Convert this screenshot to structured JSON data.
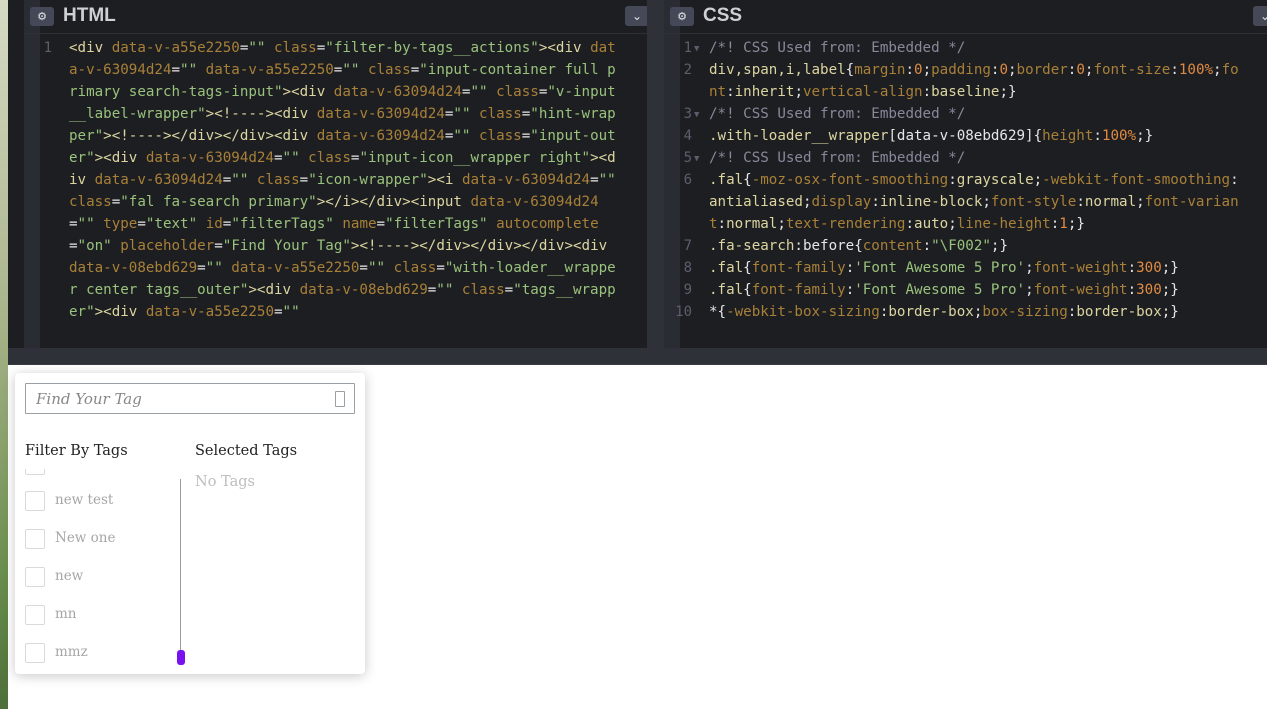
{
  "colors": {
    "editor_bg": "#1d1e22",
    "tag": "#dcd5a0",
    "attr": "#a88038",
    "value": "#99c27c",
    "comment": "#88889a",
    "number": "#e08b43",
    "accent": "#7a12f0"
  },
  "html_panel": {
    "title": "HTML",
    "settings_icon": "gear-icon",
    "collapse_icon": "chevron-down-icon",
    "lines": [
      {
        "n": "1",
        "tokens": [
          {
            "t": "<div ",
            "c": "tag"
          },
          {
            "t": "data-v-a55e2250",
            "c": "attr"
          },
          {
            "t": "=",
            "c": "plain"
          },
          {
            "t": "\"\" ",
            "c": "value"
          },
          {
            "t": "class",
            "c": "attr"
          },
          {
            "t": "=",
            "c": "plain"
          },
          {
            "t": "\"filter-by-tags__actions\"",
            "c": "value"
          },
          {
            "t": "><div ",
            "c": "tag"
          },
          {
            "t": "data-v-63094d24",
            "c": "attr"
          },
          {
            "t": "=",
            "c": "plain"
          },
          {
            "t": "\"\" ",
            "c": "value"
          },
          {
            "t": "data-v-a55e2250",
            "c": "attr"
          },
          {
            "t": "=",
            "c": "plain"
          },
          {
            "t": "\"\" ",
            "c": "value"
          },
          {
            "t": "class",
            "c": "attr"
          },
          {
            "t": "=",
            "c": "plain"
          },
          {
            "t": "\"input-container full primary search-tags-input\"",
            "c": "value"
          },
          {
            "t": "><div ",
            "c": "tag"
          },
          {
            "t": "data-v-63094d24",
            "c": "attr"
          },
          {
            "t": "=",
            "c": "plain"
          },
          {
            "t": "\"\" ",
            "c": "value"
          },
          {
            "t": "class",
            "c": "attr"
          },
          {
            "t": "=",
            "c": "plain"
          },
          {
            "t": "\"v-input__label-wrapper\"",
            "c": "value"
          },
          {
            "t": "><!---->",
            "c": "tag"
          },
          {
            "t": "<div ",
            "c": "tag"
          },
          {
            "t": "data-v-63094d24",
            "c": "attr"
          },
          {
            "t": "=",
            "c": "plain"
          },
          {
            "t": "\"\" ",
            "c": "value"
          },
          {
            "t": "class",
            "c": "attr"
          },
          {
            "t": "=",
            "c": "plain"
          },
          {
            "t": "\"hint-wrapper\"",
            "c": "value"
          },
          {
            "t": "><!----></div></div><div ",
            "c": "tag"
          },
          {
            "t": "data-v-63094d24",
            "c": "attr"
          },
          {
            "t": "=",
            "c": "plain"
          },
          {
            "t": "\"\" ",
            "c": "value"
          },
          {
            "t": "class",
            "c": "attr"
          },
          {
            "t": "=",
            "c": "plain"
          },
          {
            "t": "\"input-outer\"",
            "c": "value"
          },
          {
            "t": "><div ",
            "c": "tag"
          },
          {
            "t": "data-v-63094d24",
            "c": "attr"
          },
          {
            "t": "=",
            "c": "plain"
          },
          {
            "t": "\"\" ",
            "c": "value"
          },
          {
            "t": "class",
            "c": "attr"
          },
          {
            "t": "=",
            "c": "plain"
          },
          {
            "t": "\"input-icon__wrapper right\"",
            "c": "value"
          },
          {
            "t": "><div ",
            "c": "tag"
          },
          {
            "t": "data-v-63094d24",
            "c": "attr"
          },
          {
            "t": "=",
            "c": "plain"
          },
          {
            "t": "\"\" ",
            "c": "value"
          },
          {
            "t": "class",
            "c": "attr"
          },
          {
            "t": "=",
            "c": "plain"
          },
          {
            "t": "\"icon-wrapper\"",
            "c": "value"
          },
          {
            "t": "><i ",
            "c": "tag"
          },
          {
            "t": "data-v-63094d24",
            "c": "attr"
          },
          {
            "t": "=",
            "c": "plain"
          },
          {
            "t": "\"\" ",
            "c": "value"
          },
          {
            "t": "class",
            "c": "attr"
          },
          {
            "t": "=",
            "c": "plain"
          },
          {
            "t": "\"fal fa-search primary\"",
            "c": "value"
          },
          {
            "t": "></i></div><input ",
            "c": "tag"
          },
          {
            "t": "data-v-63094d24",
            "c": "attr"
          },
          {
            "t": "=",
            "c": "plain"
          },
          {
            "t": "\"\" ",
            "c": "value"
          },
          {
            "t": "type",
            "c": "attr"
          },
          {
            "t": "=",
            "c": "plain"
          },
          {
            "t": "\"text\" ",
            "c": "value"
          },
          {
            "t": "id",
            "c": "attr"
          },
          {
            "t": "=",
            "c": "plain"
          },
          {
            "t": "\"filterTags\" ",
            "c": "value"
          },
          {
            "t": "name",
            "c": "attr"
          },
          {
            "t": "=",
            "c": "plain"
          },
          {
            "t": "\"filterTags\" ",
            "c": "value"
          },
          {
            "t": "autocomplete",
            "c": "attr"
          },
          {
            "t": "=",
            "c": "plain"
          },
          {
            "t": "\"on\" ",
            "c": "value"
          },
          {
            "t": "placeholder",
            "c": "attr"
          },
          {
            "t": "=",
            "c": "plain"
          },
          {
            "t": "\"Find Your Tag\"",
            "c": "value"
          },
          {
            "t": "><!----></div></div></div><div ",
            "c": "tag"
          },
          {
            "t": "data-v-08ebd629",
            "c": "attr"
          },
          {
            "t": "=",
            "c": "plain"
          },
          {
            "t": "\"\" ",
            "c": "value"
          },
          {
            "t": "data-v-a55e2250",
            "c": "attr"
          },
          {
            "t": "=",
            "c": "plain"
          },
          {
            "t": "\"\" ",
            "c": "value"
          },
          {
            "t": "class",
            "c": "attr"
          },
          {
            "t": "=",
            "c": "plain"
          },
          {
            "t": "\"with-loader__wrapper center tags__outer\"",
            "c": "value"
          },
          {
            "t": "><div ",
            "c": "tag"
          },
          {
            "t": "data-v-08ebd629",
            "c": "attr"
          },
          {
            "t": "=",
            "c": "plain"
          },
          {
            "t": "\"\" ",
            "c": "value"
          },
          {
            "t": "class",
            "c": "attr"
          },
          {
            "t": "=",
            "c": "plain"
          },
          {
            "t": "\"tags__wrapper\"",
            "c": "value"
          },
          {
            "t": "><div ",
            "c": "tag"
          },
          {
            "t": "data-v-a55e2250",
            "c": "attr"
          },
          {
            "t": "=",
            "c": "plain"
          },
          {
            "t": "\"\"",
            "c": "value"
          }
        ]
      }
    ]
  },
  "css_panel": {
    "title": "CSS",
    "settings_icon": "gear-icon",
    "collapse_icon": "chevron-down-icon",
    "lines": [
      {
        "n": "1",
        "fold": true,
        "tokens": [
          {
            "t": "/*! CSS Used from: Embedded */",
            "c": "comment"
          }
        ]
      },
      {
        "n": "2",
        "tokens": [
          {
            "t": "div,span,i,label",
            "c": "tag"
          },
          {
            "t": "{",
            "c": "plain"
          },
          {
            "t": "margin",
            "c": "prop"
          },
          {
            "t": ":",
            "c": "plain"
          },
          {
            "t": "0",
            "c": "number"
          },
          {
            "t": ";",
            "c": "plain"
          },
          {
            "t": "padding",
            "c": "prop"
          },
          {
            "t": ":",
            "c": "plain"
          },
          {
            "t": "0",
            "c": "number"
          },
          {
            "t": ";",
            "c": "plain"
          },
          {
            "t": "border",
            "c": "prop"
          },
          {
            "t": ":",
            "c": "plain"
          },
          {
            "t": "0",
            "c": "number"
          },
          {
            "t": ";",
            "c": "plain"
          },
          {
            "t": "font-size",
            "c": "prop"
          },
          {
            "t": ":",
            "c": "plain"
          },
          {
            "t": "100%",
            "c": "number"
          },
          {
            "t": ";",
            "c": "plain"
          },
          {
            "t": "font",
            "c": "prop"
          },
          {
            "t": ":",
            "c": "plain"
          },
          {
            "t": "inherit",
            "c": "kw"
          },
          {
            "t": ";",
            "c": "plain"
          },
          {
            "t": "vertical-align",
            "c": "prop"
          },
          {
            "t": ":",
            "c": "plain"
          },
          {
            "t": "baseline",
            "c": "kw"
          },
          {
            "t": ";}",
            "c": "plain"
          }
        ]
      },
      {
        "n": "3",
        "fold": true,
        "tokens": [
          {
            "t": "/*! CSS Used from: Embedded */",
            "c": "comment"
          }
        ]
      },
      {
        "n": "4",
        "tokens": [
          {
            "t": ".with-loader__wrapper",
            "c": "tag"
          },
          {
            "t": "[data-v-08ebd629]",
            "c": "plain"
          },
          {
            "t": "{",
            "c": "plain"
          },
          {
            "t": "height",
            "c": "prop"
          },
          {
            "t": ":",
            "c": "plain"
          },
          {
            "t": "100%",
            "c": "number"
          },
          {
            "t": ";}",
            "c": "plain"
          }
        ]
      },
      {
        "n": "5",
        "fold": true,
        "tokens": [
          {
            "t": "/*! CSS Used from: Embedded */",
            "c": "comment"
          }
        ]
      },
      {
        "n": "6",
        "tokens": [
          {
            "t": ".fal",
            "c": "tag"
          },
          {
            "t": "{",
            "c": "plain"
          },
          {
            "t": "-moz-osx-font-smoothing",
            "c": "prop"
          },
          {
            "t": ":",
            "c": "plain"
          },
          {
            "t": "grayscale",
            "c": "kw"
          },
          {
            "t": ";",
            "c": "plain"
          },
          {
            "t": "-webkit-font-smoothing",
            "c": "prop"
          },
          {
            "t": ":",
            "c": "plain"
          },
          {
            "t": "antialiased",
            "c": "kw"
          },
          {
            "t": ";",
            "c": "plain"
          },
          {
            "t": "display",
            "c": "prop"
          },
          {
            "t": ":",
            "c": "plain"
          },
          {
            "t": "inline-block",
            "c": "kw"
          },
          {
            "t": ";",
            "c": "plain"
          },
          {
            "t": "font-style",
            "c": "prop"
          },
          {
            "t": ":",
            "c": "plain"
          },
          {
            "t": "normal",
            "c": "kw"
          },
          {
            "t": ";",
            "c": "plain"
          },
          {
            "t": "font-variant",
            "c": "prop"
          },
          {
            "t": ":",
            "c": "plain"
          },
          {
            "t": "normal",
            "c": "kw"
          },
          {
            "t": ";",
            "c": "plain"
          },
          {
            "t": "text-rendering",
            "c": "prop"
          },
          {
            "t": ":",
            "c": "plain"
          },
          {
            "t": "auto",
            "c": "kw"
          },
          {
            "t": ";",
            "c": "plain"
          },
          {
            "t": "line-height",
            "c": "prop"
          },
          {
            "t": ":",
            "c": "plain"
          },
          {
            "t": "1",
            "c": "number"
          },
          {
            "t": ";}",
            "c": "plain"
          }
        ]
      },
      {
        "n": "7",
        "tokens": [
          {
            "t": ".fa-search",
            "c": "tag"
          },
          {
            "t": ":before{",
            "c": "plain"
          },
          {
            "t": "content",
            "c": "prop"
          },
          {
            "t": ":",
            "c": "plain"
          },
          {
            "t": "\"\\F002\"",
            "c": "value"
          },
          {
            "t": ";}",
            "c": "plain"
          }
        ]
      },
      {
        "n": "8",
        "tokens": [
          {
            "t": ".fal",
            "c": "tag"
          },
          {
            "t": "{",
            "c": "plain"
          },
          {
            "t": "font-family",
            "c": "prop"
          },
          {
            "t": ":",
            "c": "plain"
          },
          {
            "t": "'Font Awesome 5 Pro'",
            "c": "value"
          },
          {
            "t": ";",
            "c": "plain"
          },
          {
            "t": "font-weight",
            "c": "prop"
          },
          {
            "t": ":",
            "c": "plain"
          },
          {
            "t": "300",
            "c": "number"
          },
          {
            "t": ";}",
            "c": "plain"
          }
        ]
      },
      {
        "n": "9",
        "tokens": [
          {
            "t": ".fal",
            "c": "tag"
          },
          {
            "t": "{",
            "c": "plain"
          },
          {
            "t": "font-family",
            "c": "prop"
          },
          {
            "t": ":",
            "c": "plain"
          },
          {
            "t": "'Font Awesome 5 Pro'",
            "c": "value"
          },
          {
            "t": ";",
            "c": "plain"
          },
          {
            "t": "font-weight",
            "c": "prop"
          },
          {
            "t": ":",
            "c": "plain"
          },
          {
            "t": "300",
            "c": "number"
          },
          {
            "t": ";}",
            "c": "plain"
          }
        ]
      },
      {
        "n": "10",
        "tokens": [
          {
            "t": "*",
            "c": "plain"
          },
          {
            "t": "{",
            "c": "plain"
          },
          {
            "t": "-webkit-box-sizing",
            "c": "prop"
          },
          {
            "t": ":",
            "c": "plain"
          },
          {
            "t": "border-box",
            "c": "kw"
          },
          {
            "t": ";",
            "c": "plain"
          },
          {
            "t": "box-sizing",
            "c": "prop"
          },
          {
            "t": ":",
            "c": "plain"
          },
          {
            "t": "border-box",
            "c": "kw"
          },
          {
            "t": ";}",
            "c": "plain"
          }
        ]
      }
    ]
  },
  "widget": {
    "search": {
      "placeholder": "Find Your Tag",
      "value": "",
      "icon": "search-icon"
    },
    "filter_title": "Filter By Tags",
    "selected_title": "Selected Tags",
    "no_tags": "No Tags",
    "tags": [
      "new test",
      "New one",
      "new",
      "mn",
      "mmz"
    ],
    "scroll_position": 1.0
  }
}
